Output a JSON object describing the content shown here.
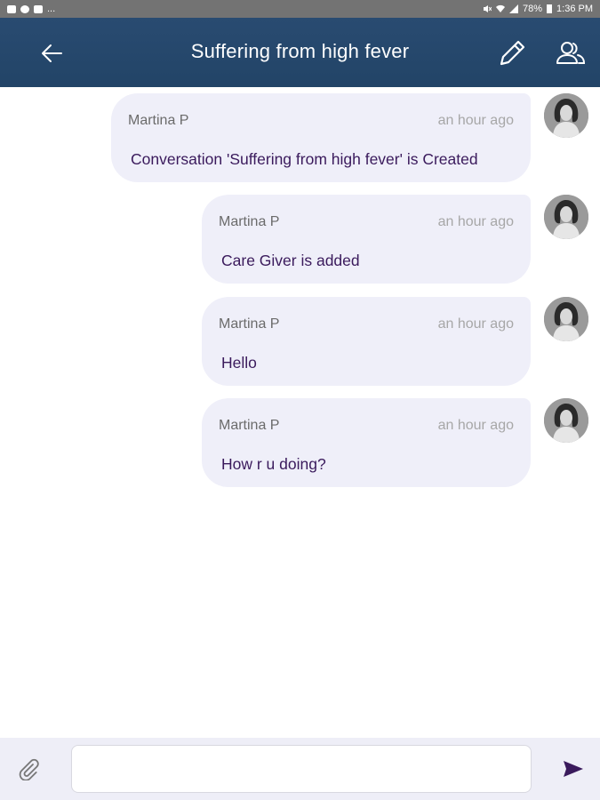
{
  "status_bar": {
    "left_icons": [
      "gallery-icon",
      "ring-icon",
      "youtube-icon",
      "more-dots"
    ],
    "more": "...",
    "battery": "78%",
    "time": "1:36 PM"
  },
  "header": {
    "title": "Suffering from high fever",
    "back_icon": "arrow-left-icon",
    "edit_icon": "pencil-icon",
    "participants_icon": "people-icon",
    "color": "#294b71"
  },
  "messages": [
    {
      "sender": "Martina P",
      "time": "an hour ago",
      "text": "Conversation 'Suffering from high fever' is Created"
    },
    {
      "sender": "Martina P",
      "time": "an hour ago",
      "text": "Care Giver  is added"
    },
    {
      "sender": "Martina P",
      "time": "an hour ago",
      "text": "Hello"
    },
    {
      "sender": "Martina P",
      "time": "an hour ago",
      "text": "How r u doing?"
    }
  ],
  "composer": {
    "value": "",
    "placeholder": "",
    "attach_icon": "paperclip-icon",
    "send_icon": "send-icon"
  },
  "colors": {
    "bubble": "#efeff9",
    "message_text": "#3a1a5c",
    "composer_bg": "#eeeef7"
  }
}
